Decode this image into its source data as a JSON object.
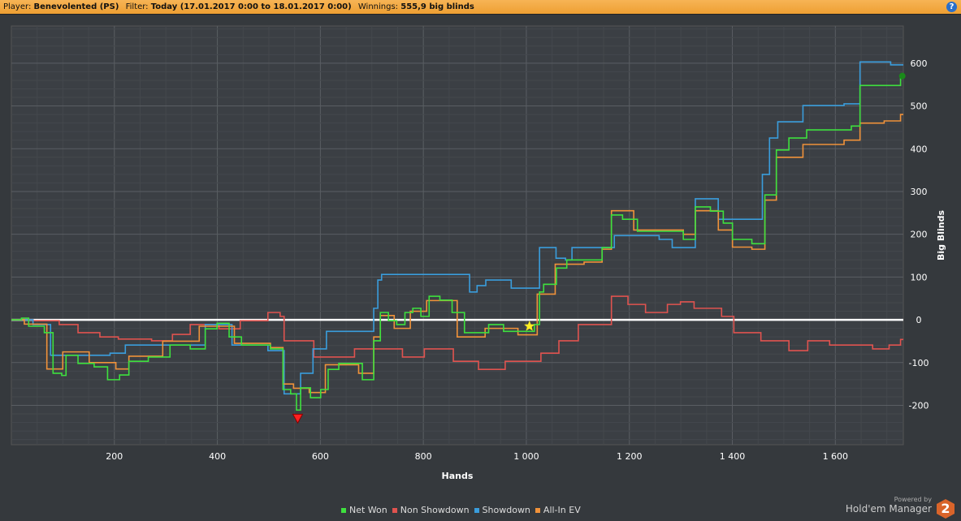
{
  "header": {
    "player_label": "Player:",
    "player": "Benevolented (PS)",
    "filter_label": "Filter:",
    "filter": "Today (17.01.2017 0:00 to 18.01.2017 0:00)",
    "winnings_label": "Winnings:",
    "winnings": "555,9 big blinds",
    "help": "?"
  },
  "brand": {
    "powered": "Powered by",
    "name": "Hold'em Manager",
    "logo": "2"
  },
  "chart_data": {
    "type": "line",
    "title": "",
    "xlabel": "Hands",
    "ylabel": "Big Blinds",
    "xlim": [
      0,
      1732
    ],
    "ylim": [
      -292,
      687
    ],
    "xticks": [
      200,
      400,
      600,
      800,
      1000,
      1200,
      1400,
      1600
    ],
    "xtick_labels": [
      "200",
      "400",
      "600",
      "800",
      "1 000",
      "1 200",
      "1 400",
      "1 600"
    ],
    "yticks": [
      -200,
      -100,
      0,
      100,
      200,
      300,
      400,
      500,
      600
    ],
    "grid": true,
    "legend": "bottom",
    "series": [
      {
        "name": "Non Showdown",
        "color": "#e0534f",
        "points": [
          [
            0,
            0
          ],
          [
            60,
            -2
          ],
          [
            107,
            -11
          ],
          [
            139,
            -30
          ],
          [
            186,
            -40
          ],
          [
            217,
            -45
          ],
          [
            296,
            -49
          ],
          [
            320,
            -34
          ],
          [
            359,
            -11
          ],
          [
            422,
            -21
          ],
          [
            454,
            -2
          ],
          [
            517,
            17
          ],
          [
            524,
            8
          ],
          [
            532,
            -49
          ],
          [
            611,
            -87
          ],
          [
            690,
            -68
          ],
          [
            737,
            -68
          ],
          [
            769,
            -87
          ],
          [
            816,
            -68
          ],
          [
            847,
            -68
          ],
          [
            863,
            -97
          ],
          [
            926,
            -116
          ],
          [
            973,
            -97
          ],
          [
            1052,
            -78
          ],
          [
            1068,
            -49
          ],
          [
            1115,
            -11
          ],
          [
            1154,
            -11
          ],
          [
            1170,
            55
          ],
          [
            1209,
            36
          ],
          [
            1241,
            17
          ],
          [
            1288,
            36
          ],
          [
            1304,
            42
          ],
          [
            1335,
            27
          ],
          [
            1398,
            8
          ],
          [
            1405,
            -30
          ],
          [
            1477,
            -49
          ],
          [
            1524,
            -72
          ],
          [
            1556,
            -49
          ],
          [
            1603,
            -59
          ],
          [
            1650,
            -59
          ],
          [
            1682,
            -68
          ],
          [
            1714,
            -59
          ],
          [
            1732,
            -46
          ]
        ]
      },
      {
        "name": "Showdown",
        "color": "#3a9ddc",
        "points": [
          [
            0,
            0
          ],
          [
            60,
            -11
          ],
          [
            83,
            -83
          ],
          [
            186,
            -83
          ],
          [
            194,
            -78
          ],
          [
            233,
            -59
          ],
          [
            320,
            -59
          ],
          [
            359,
            -59
          ],
          [
            384,
            -11
          ],
          [
            406,
            -11
          ],
          [
            438,
            -59
          ],
          [
            524,
            -72
          ],
          [
            532,
            -173
          ],
          [
            556,
            -173
          ],
          [
            564,
            -125
          ],
          [
            595,
            -68
          ],
          [
            619,
            -27
          ],
          [
            698,
            -27
          ],
          [
            706,
            27
          ],
          [
            714,
            93
          ],
          [
            721,
            106
          ],
          [
            887,
            106
          ],
          [
            891,
            65
          ],
          [
            910,
            80
          ],
          [
            926,
            93
          ],
          [
            965,
            93
          ],
          [
            973,
            74
          ],
          [
            1020,
            74
          ],
          [
            1028,
            169
          ],
          [
            1052,
            169
          ],
          [
            1060,
            144
          ],
          [
            1083,
            140
          ],
          [
            1091,
            169
          ],
          [
            1154,
            169
          ],
          [
            1178,
            197
          ],
          [
            1225,
            197
          ],
          [
            1272,
            188
          ],
          [
            1288,
            169
          ],
          [
            1312,
            169
          ],
          [
            1335,
            283
          ],
          [
            1367,
            283
          ],
          [
            1375,
            235
          ],
          [
            1452,
            235
          ],
          [
            1461,
            340
          ],
          [
            1477,
            425
          ],
          [
            1493,
            463
          ],
          [
            1556,
            501
          ],
          [
            1643,
            505
          ],
          [
            1650,
            603
          ],
          [
            1732,
            596
          ]
        ]
      },
      {
        "name": "All-In EV",
        "color": "#f0923a",
        "points": [
          [
            0,
            0
          ],
          [
            36,
            -10
          ],
          [
            83,
            -115
          ],
          [
            107,
            -75
          ],
          [
            170,
            -100
          ],
          [
            217,
            -115
          ],
          [
            233,
            -85
          ],
          [
            320,
            -50
          ],
          [
            384,
            -15
          ],
          [
            454,
            -55
          ],
          [
            524,
            -65
          ],
          [
            529,
            -150
          ],
          [
            556,
            -160
          ],
          [
            588,
            -170
          ],
          [
            619,
            -105
          ],
          [
            698,
            -125
          ],
          [
            706,
            -40
          ],
          [
            721,
            10
          ],
          [
            753,
            -20
          ],
          [
            784,
            20
          ],
          [
            816,
            45
          ],
          [
            887,
            -40
          ],
          [
            934,
            -20
          ],
          [
            1005,
            -35
          ],
          [
            1028,
            60
          ],
          [
            1068,
            130
          ],
          [
            1131,
            135
          ],
          [
            1154,
            165
          ],
          [
            1170,
            255
          ],
          [
            1225,
            210
          ],
          [
            1288,
            210
          ],
          [
            1312,
            200
          ],
          [
            1335,
            255
          ],
          [
            1389,
            210
          ],
          [
            1405,
            170
          ],
          [
            1452,
            165
          ],
          [
            1468,
            280
          ],
          [
            1493,
            380
          ],
          [
            1556,
            410
          ],
          [
            1643,
            420
          ],
          [
            1650,
            460
          ],
          [
            1714,
            465
          ],
          [
            1732,
            480
          ]
        ]
      },
      {
        "name": "Net Won",
        "color": "#3ee03e",
        "points": [
          [
            0,
            0
          ],
          [
            28,
            4
          ],
          [
            36,
            -15
          ],
          [
            76,
            -30
          ],
          [
            83,
            -125
          ],
          [
            104,
            -130
          ],
          [
            107,
            -83
          ],
          [
            139,
            -102
          ],
          [
            170,
            -110
          ],
          [
            194,
            -140
          ],
          [
            217,
            -129
          ],
          [
            233,
            -97
          ],
          [
            280,
            -87
          ],
          [
            320,
            -59
          ],
          [
            359,
            -68
          ],
          [
            384,
            -21
          ],
          [
            406,
            -8
          ],
          [
            430,
            -40
          ],
          [
            454,
            -59
          ],
          [
            524,
            -68
          ],
          [
            529,
            -163
          ],
          [
            548,
            -173
          ],
          [
            556,
            -211
          ],
          [
            564,
            -159
          ],
          [
            588,
            -182
          ],
          [
            606,
            -163
          ],
          [
            619,
            -116
          ],
          [
            643,
            -102
          ],
          [
            698,
            -140
          ],
          [
            706,
            -49
          ],
          [
            721,
            17
          ],
          [
            737,
            -2
          ],
          [
            753,
            -11
          ],
          [
            769,
            17
          ],
          [
            784,
            27
          ],
          [
            800,
            8
          ],
          [
            816,
            55
          ],
          [
            839,
            46
          ],
          [
            863,
            17
          ],
          [
            887,
            -30
          ],
          [
            910,
            -30
          ],
          [
            934,
            -11
          ],
          [
            965,
            -27
          ],
          [
            1005,
            -27
          ],
          [
            1020,
            -11
          ],
          [
            1028,
            65
          ],
          [
            1036,
            83
          ],
          [
            1068,
            121
          ],
          [
            1083,
            140
          ],
          [
            1131,
            140
          ],
          [
            1154,
            169
          ],
          [
            1170,
            245
          ],
          [
            1194,
            235
          ],
          [
            1225,
            207
          ],
          [
            1288,
            207
          ],
          [
            1312,
            188
          ],
          [
            1335,
            264
          ],
          [
            1367,
            254
          ],
          [
            1389,
            226
          ],
          [
            1405,
            188
          ],
          [
            1452,
            178
          ],
          [
            1468,
            292
          ],
          [
            1493,
            397
          ],
          [
            1517,
            425
          ],
          [
            1556,
            444
          ],
          [
            1603,
            444
          ],
          [
            1643,
            453
          ],
          [
            1650,
            548
          ],
          [
            1714,
            548
          ],
          [
            1732,
            567
          ]
        ]
      }
    ],
    "markers": [
      {
        "type": "min",
        "hand": 556,
        "value": -230,
        "color": "#ff2020"
      },
      {
        "type": "star",
        "hand": 1006,
        "value": -15,
        "color": "#ffee22"
      },
      {
        "type": "end",
        "hand": 1730,
        "value": 570,
        "color": "#1a8a1a"
      }
    ],
    "legend_order": [
      "Net Won",
      "Non Showdown",
      "Showdown",
      "All-In EV"
    ]
  }
}
